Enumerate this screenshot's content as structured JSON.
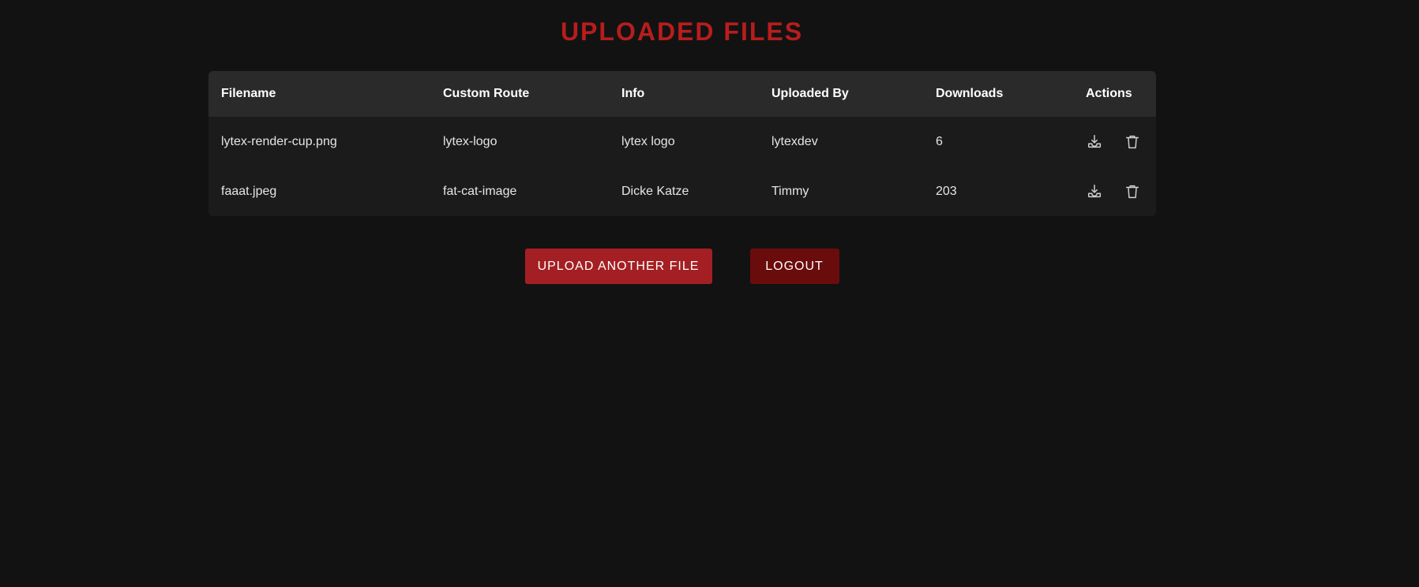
{
  "page": {
    "title": "UPLOADED FILES"
  },
  "table": {
    "headers": {
      "filename": "Filename",
      "custom_route": "Custom Route",
      "info": "Info",
      "uploaded_by": "Uploaded By",
      "downloads": "Downloads",
      "actions": "Actions"
    },
    "rows": [
      {
        "filename": "lytex-render-cup.png",
        "custom_route": "lytex-logo",
        "info": "lytex logo",
        "uploaded_by": "lytexdev",
        "downloads": "6"
      },
      {
        "filename": "faaat.jpeg",
        "custom_route": "fat-cat-image",
        "info": "Dicke Katze",
        "uploaded_by": "Timmy",
        "downloads": "203"
      }
    ],
    "action_icons": [
      "download-icon",
      "trash-icon"
    ]
  },
  "buttons": {
    "upload_label": "UPLOAD ANOTHER FILE",
    "logout_label": "LOGOUT"
  },
  "colors": {
    "background": "#121212",
    "accent_title": "#b81d1d",
    "upload_button": "#a41f23",
    "logout_button": "#6a0c0c",
    "table_header_bg": "#2a2a2a",
    "table_row_bg": "#1b1b1b"
  }
}
